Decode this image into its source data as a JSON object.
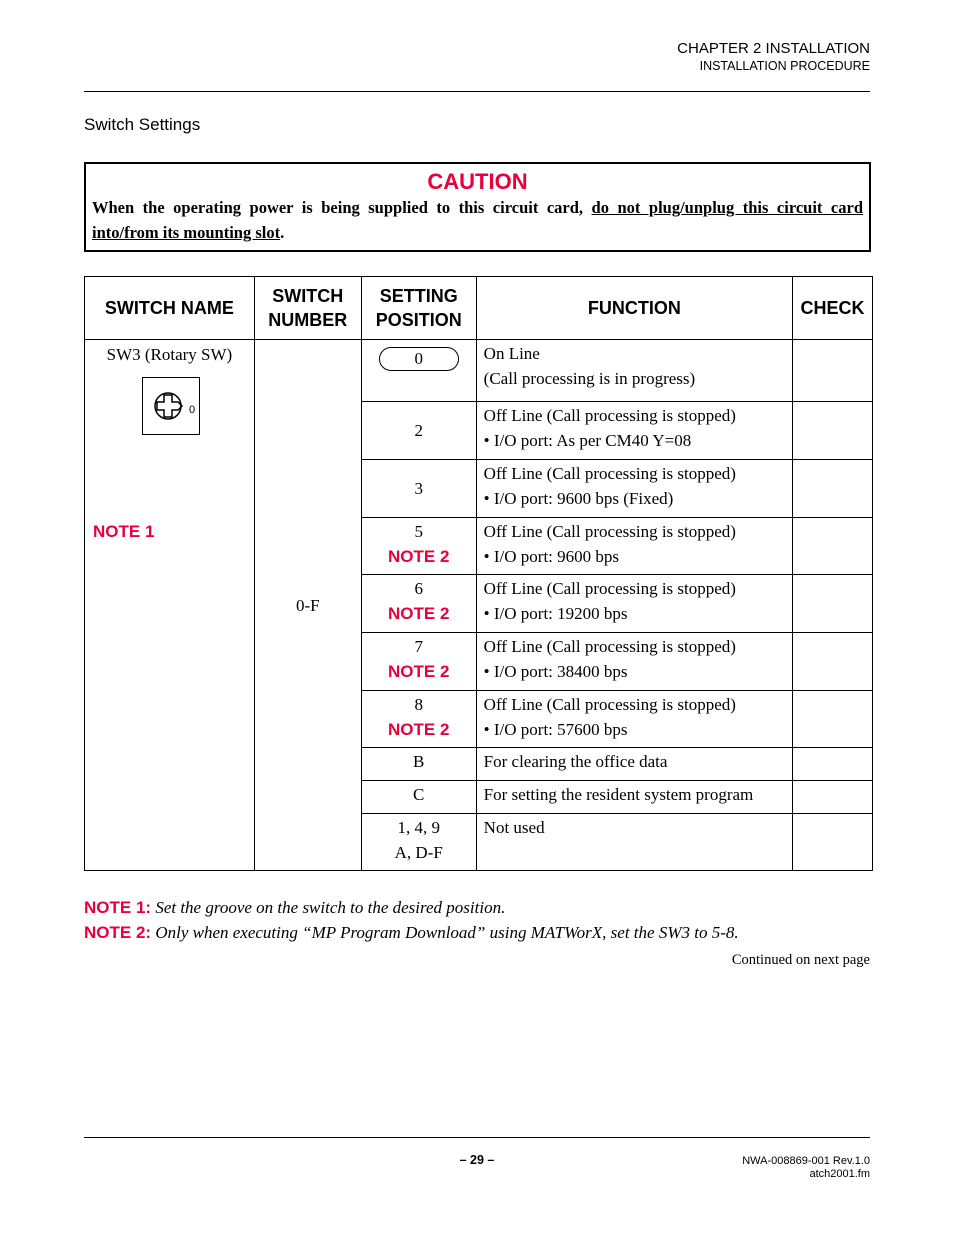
{
  "header": {
    "chapter": "CHAPTER 2  INSTALLATION",
    "subtitle": "INSTALLATION PROCEDURE"
  },
  "section_title": "Switch Settings",
  "caution": {
    "title": "CAUTION",
    "text_plain": "When the operating power is being supplied to this circuit card, ",
    "text_underlined": "do not plug/unplug this circuit card into/from its mounting slot",
    "text_end": "."
  },
  "table": {
    "headers": {
      "switch_name": "SWITCH NAME",
      "switch_number_1": "SWITCH",
      "switch_number_2": "NUMBER",
      "setting_position_1": "SETTING",
      "setting_position_2": "POSITION",
      "function": "FUNCTION",
      "check": "CHECK"
    },
    "switch_name": "SW3 (Rotary SW)",
    "switch_icon_label": "0",
    "switch_name_note": "NOTE 1",
    "switch_number": "0-F",
    "rows": [
      {
        "position": "0",
        "note": "",
        "function_1": "On Line",
        "function_2": "(Call processing is in progress)"
      },
      {
        "position": "2",
        "note": "",
        "function_1": "Off Line (Call processing is stopped)",
        "function_2": "• I/O port: As per CM40 Y=08"
      },
      {
        "position": "3",
        "note": "",
        "function_1": "Off Line (Call processing is stopped)",
        "function_2": "• I/O port: 9600 bps (Fixed)"
      },
      {
        "position": "5",
        "note": "NOTE 2",
        "function_1": "Off Line (Call processing is stopped)",
        "function_2": "• I/O port: 9600 bps"
      },
      {
        "position": "6",
        "note": "NOTE 2",
        "function_1": "Off Line (Call processing is stopped)",
        "function_2": "• I/O port: 19200 bps"
      },
      {
        "position": "7",
        "note": "NOTE 2",
        "function_1": "Off Line (Call processing is stopped)",
        "function_2": "• I/O port: 38400 bps"
      },
      {
        "position": "8",
        "note": "NOTE 2",
        "function_1": "Off Line (Call processing is stopped)",
        "function_2": "• I/O port: 57600 bps"
      },
      {
        "position": "B",
        "note": "",
        "function_1": "For clearing the office data",
        "function_2": ""
      },
      {
        "position": "C",
        "note": "",
        "function_1": "For setting the resident system program",
        "function_2": ""
      },
      {
        "position": "1, 4, 9",
        "position_2": "A, D-F",
        "note": "",
        "function_1": "Not used",
        "function_2": ""
      }
    ]
  },
  "notes": [
    {
      "label": "NOTE 1:",
      "text": "Set the groove on the switch to the desired position."
    },
    {
      "label": "NOTE 2:",
      "text": "Only when executing “MP Program Download” using MATWorX, set the SW3 to 5-8."
    }
  ],
  "continued": "Continued on next page",
  "footer": {
    "page": "– 29 –",
    "doc_id": "NWA-008869-001 Rev.1.0",
    "file": "atch2001.fm"
  }
}
